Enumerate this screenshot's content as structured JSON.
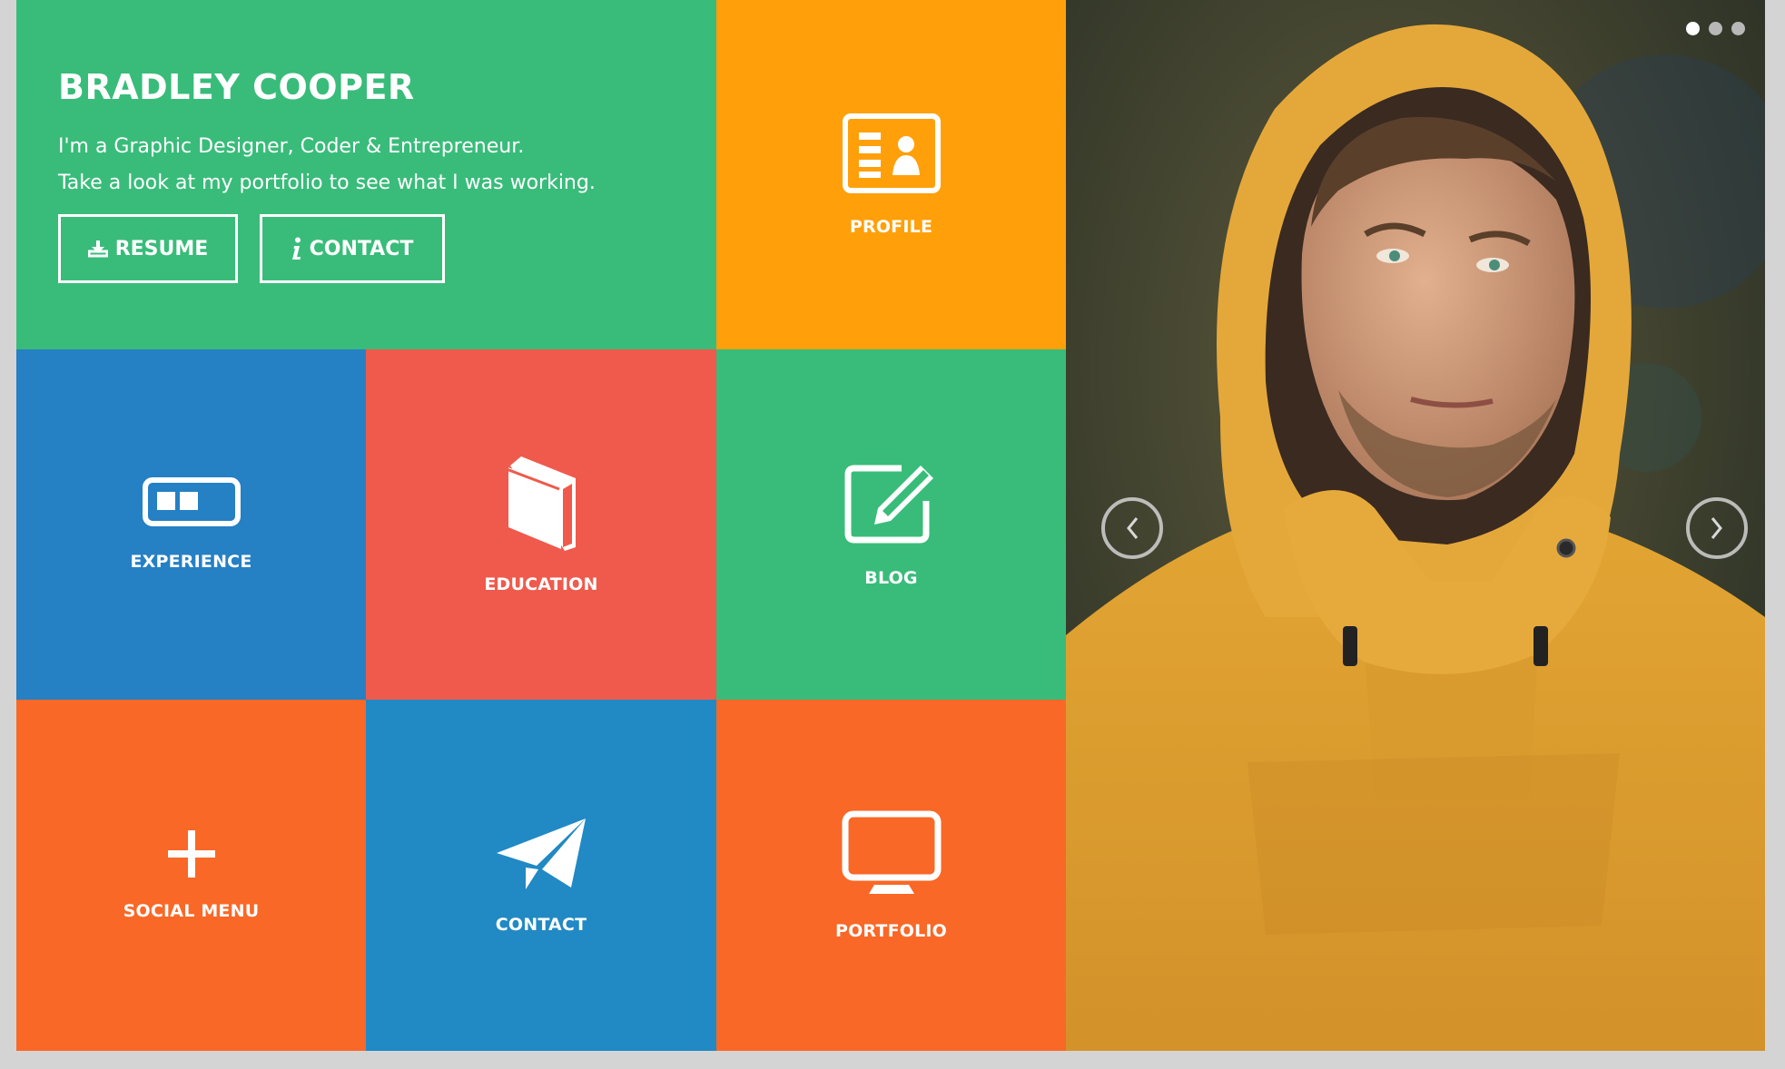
{
  "intro": {
    "name": "BRADLEY COOPER",
    "tagline_line1": "I'm a Graphic Designer, Coder & Entrepreneur.",
    "tagline_line2": "Take a look at my portfolio to see what I was working.",
    "resume_button": "RESUME",
    "contact_button": "CONTACT",
    "resume_icon": "download-icon",
    "contact_icon": "info-icon"
  },
  "tiles": {
    "profile": {
      "label": "PROFILE",
      "icon": "id-card-icon"
    },
    "experience": {
      "label": "EXPERIENCE",
      "icon": "progress-bar-icon"
    },
    "education": {
      "label": "EDUCATION",
      "icon": "book-icon"
    },
    "blog": {
      "label": "BLOG",
      "icon": "edit-icon"
    },
    "social": {
      "label": "SOCIAL MENU",
      "icon": "plus-icon"
    },
    "contact": {
      "label": "CONTACT",
      "icon": "paper-plane-icon"
    },
    "portfolio": {
      "label": "PORTFOLIO",
      "icon": "monitor-icon"
    }
  },
  "slider": {
    "prev_icon": "chevron-left-icon",
    "next_icon": "chevron-right-icon",
    "dots_total": 3,
    "active_dot": 1
  },
  "colors": {
    "green": "#39bc7a",
    "orange": "#ffa00a",
    "blue": "#2580c4",
    "red": "#ef5a4c",
    "deep_orange": "#f96827",
    "contact_blue": "#2189c4"
  }
}
